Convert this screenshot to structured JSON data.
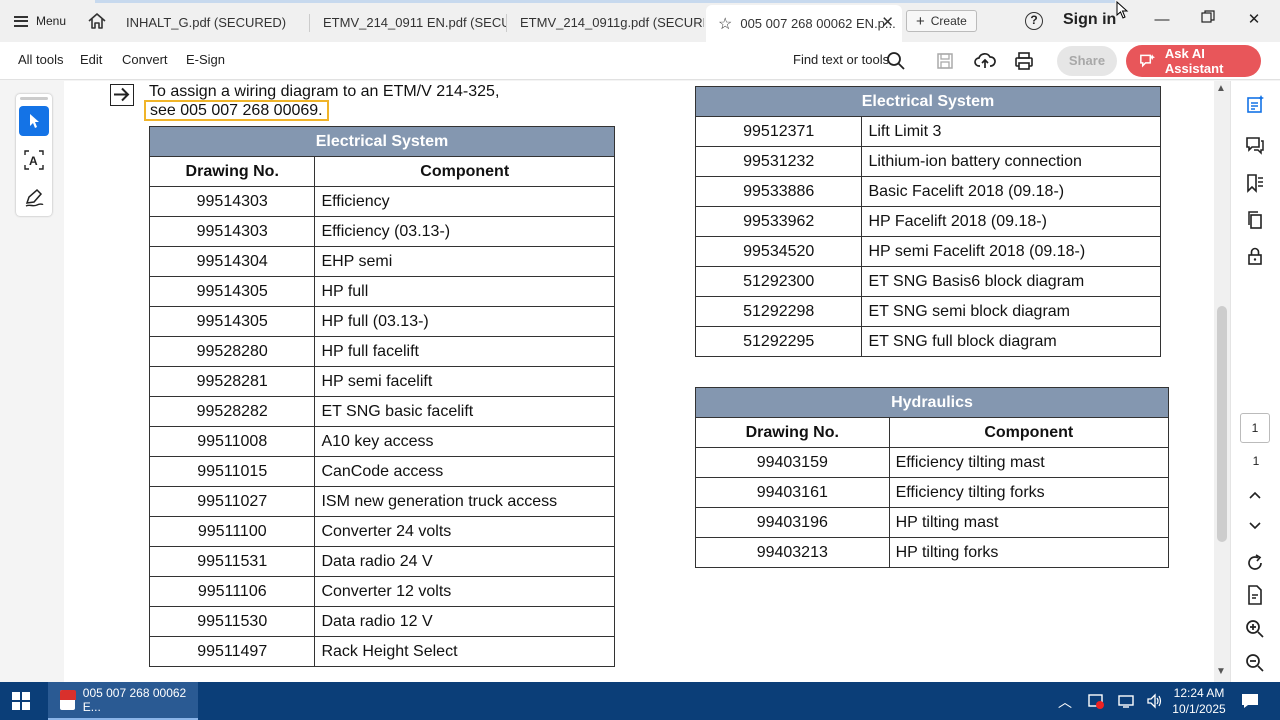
{
  "titlebar": {
    "menu_label": "Menu",
    "tabs": [
      {
        "label": "INHALT_G.pdf (SECURED)"
      },
      {
        "label": "ETMV_214_0911 EN.pdf (SECUR..."
      },
      {
        "label": "ETMV_214_0911g.pdf (SECURED)"
      },
      {
        "label": "005 007 268 00062 EN.p..."
      }
    ],
    "create_label": "Create",
    "help_label": "?",
    "sign_in": "Sign in"
  },
  "toolbar": {
    "all_tools": "All tools",
    "edit": "Edit",
    "convert": "Convert",
    "esign": "E-Sign",
    "find": "Find text or tools",
    "share": "Share",
    "ai_assistant": "Ask AI Assistant"
  },
  "document": {
    "note_line1": "To assign a wiring diagram to an ETM/V 214-325,",
    "note_line2": "see 005 007 268 00069.",
    "left_table": {
      "title": "Electrical System",
      "headers": [
        "Drawing No.",
        "Component"
      ],
      "rows": [
        [
          "99514303",
          "Efficiency"
        ],
        [
          "99514303",
          "Efficiency (03.13-)"
        ],
        [
          "99514304",
          "EHP semi"
        ],
        [
          "99514305",
          "HP full"
        ],
        [
          "99514305",
          "HP full (03.13-)"
        ],
        [
          "99528280",
          "HP full facelift"
        ],
        [
          "99528281",
          "HP semi facelift"
        ],
        [
          "99528282",
          "ET SNG basic facelift"
        ],
        [
          "99511008",
          "A10 key access"
        ],
        [
          "99511015",
          "CanCode access"
        ],
        [
          "99511027",
          "ISM new generation truck access"
        ],
        [
          "99511100",
          "Converter 24 volts"
        ],
        [
          "99511531",
          "Data radio 24 V"
        ],
        [
          "99511106",
          "Converter 12 volts"
        ],
        [
          "99511530",
          "Data radio 12 V"
        ],
        [
          "99511497",
          "Rack Height Select"
        ]
      ]
    },
    "right_table": {
      "title": "Electrical System",
      "rows": [
        [
          "99512371",
          "Lift Limit 3"
        ],
        [
          "99531232",
          "Lithium-ion battery connection"
        ],
        [
          "99533886",
          "Basic Facelift 2018 (09.18-)"
        ],
        [
          "99533962",
          "HP Facelift 2018 (09.18-)"
        ],
        [
          "99534520",
          "HP semi Facelift 2018 (09.18-)"
        ],
        [
          "51292300",
          "ET SNG Basis6 block diagram"
        ],
        [
          "51292298",
          "ET SNG semi block diagram"
        ],
        [
          "51292295",
          "ET SNG full block diagram"
        ]
      ]
    },
    "hydraulics_table": {
      "title": "Hydraulics",
      "headers": [
        "Drawing No.",
        "Component"
      ],
      "rows": [
        [
          "99403159",
          "Efficiency tilting mast"
        ],
        [
          "99403161",
          "Efficiency tilting forks"
        ],
        [
          "99403196",
          "HP tilting mast"
        ],
        [
          "99403213",
          "HP tilting forks"
        ]
      ]
    }
  },
  "pager": {
    "current": "1",
    "total": "1"
  },
  "taskbar": {
    "app_label": "005 007 268 00062 E...",
    "time": "12:24 AM",
    "date": "10/1/2025"
  },
  "colors": {
    "table_header": "#8497b0",
    "accent_blue": "#1473e6",
    "ai_button": "#e8565a",
    "highlight": "#f0b429",
    "taskbar": "#0b3e78"
  }
}
